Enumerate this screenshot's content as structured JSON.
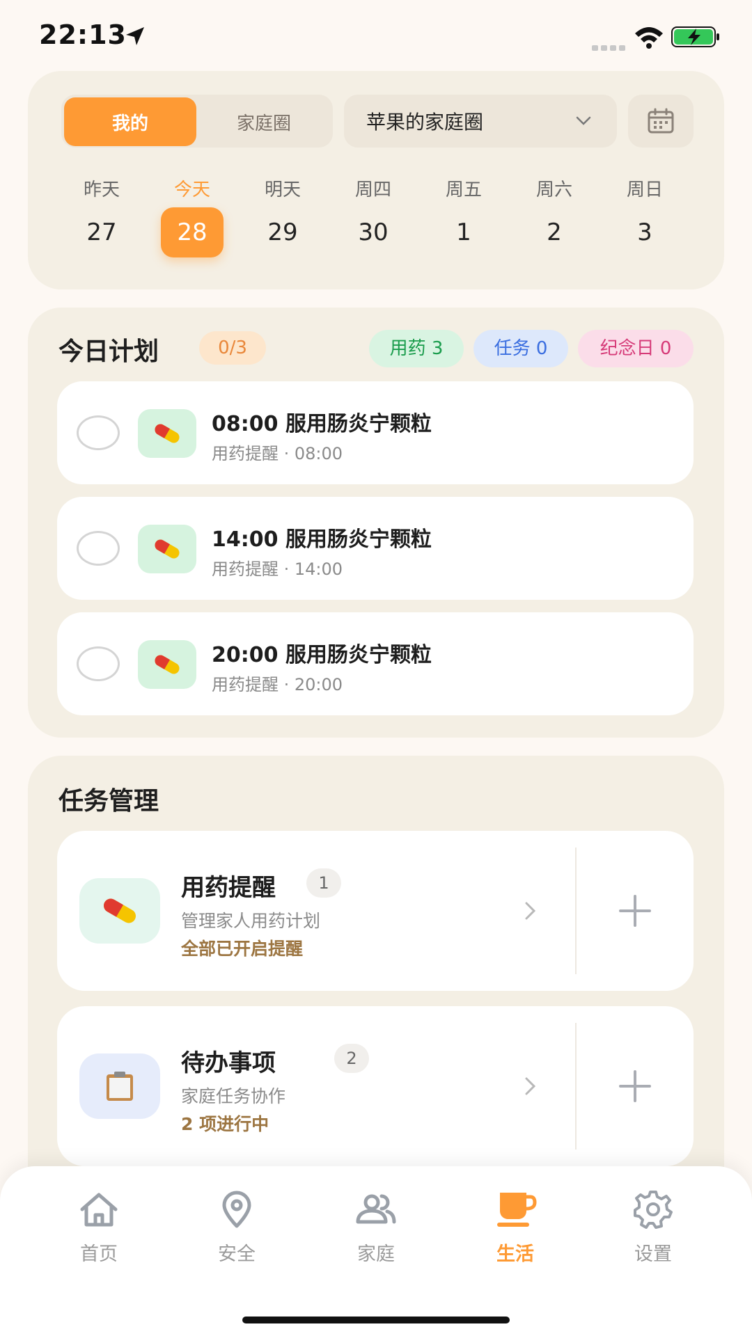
{
  "status_bar": {
    "time": "22:13"
  },
  "colors": {
    "accent": "#fe9a34",
    "card_bg": "#f4efe4",
    "page_bg": "#fdf8f3",
    "battery": "#34c759"
  },
  "header": {
    "tab_mine": "我的",
    "tab_family": "家庭圈",
    "family_circle": "苹果的家庭圈",
    "calendar_icon": "calendar-icon"
  },
  "week": [
    {
      "label": "昨天",
      "num": "27",
      "today": false
    },
    {
      "label": "今天",
      "num": "28",
      "today": true
    },
    {
      "label": "明天",
      "num": "29",
      "today": false
    },
    {
      "label": "周四",
      "num": "30",
      "today": false
    },
    {
      "label": "周五",
      "num": "1",
      "today": false
    },
    {
      "label": "周六",
      "num": "2",
      "today": false
    },
    {
      "label": "周日",
      "num": "3",
      "today": false
    }
  ],
  "plan": {
    "title": "今日计划",
    "count": "0/3",
    "badge_med": "用药 3",
    "badge_task": "任务 0",
    "badge_anniv": "纪念日 0",
    "items": [
      {
        "title": "08:00 服用肠炎宁颗粒",
        "sub": "用药提醒 · 08:00"
      },
      {
        "title": "14:00 服用肠炎宁颗粒",
        "sub": "用药提醒 · 14:00"
      },
      {
        "title": "20:00 服用肠炎宁颗粒",
        "sub": "用药提醒 · 20:00"
      }
    ]
  },
  "tasks": {
    "title": "任务管理",
    "items": [
      {
        "name": "用药提醒",
        "num": "1",
        "desc": "管理家人用药计划",
        "status": "全部已开启提醒",
        "icon": "pill-icon"
      },
      {
        "name": "待办事项",
        "num": "2",
        "desc": "家庭任务协作",
        "status": "2 项进行中",
        "icon": "clipboard-icon"
      }
    ]
  },
  "tabbar": {
    "home": "首页",
    "safety": "安全",
    "family": "家庭",
    "life": "生活",
    "settings": "设置"
  }
}
